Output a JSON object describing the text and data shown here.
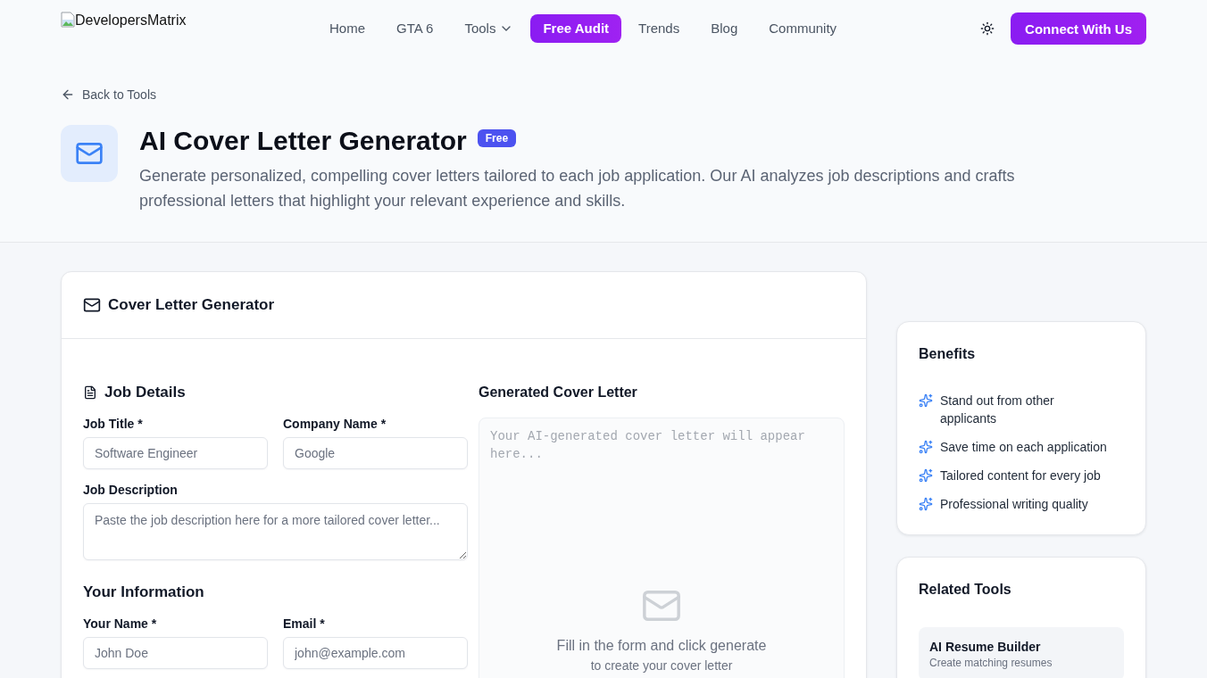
{
  "header": {
    "logo_alt": "DevelopersMatrix",
    "nav": [
      {
        "label": "Home",
        "kind": "link"
      },
      {
        "label": "GTA 6",
        "kind": "link"
      },
      {
        "label": "Tools",
        "kind": "dropdown"
      },
      {
        "label": "Free Audit",
        "kind": "highlight"
      },
      {
        "label": "Trends",
        "kind": "link"
      },
      {
        "label": "Blog",
        "kind": "link"
      },
      {
        "label": "Community",
        "kind": "link"
      }
    ],
    "cta": "Connect With Us"
  },
  "back_link": "Back to Tools",
  "hero": {
    "title": "AI Cover Letter Generator",
    "badge": "Free",
    "description": "Generate personalized, compelling cover letters tailored to each job application. Our AI analyzes job descriptions and crafts professional letters that highlight your relevant experience and skills."
  },
  "generator": {
    "title": "Cover Letter Generator",
    "job_details": {
      "heading": "Job Details",
      "fields": [
        {
          "label": "Job Title *",
          "placeholder": "Software Engineer",
          "kind": "input"
        },
        {
          "label": "Company Name *",
          "placeholder": "Google",
          "kind": "input"
        },
        {
          "label": "Job Description",
          "placeholder": "Paste the job description here for a more tailored cover letter...",
          "kind": "textarea"
        }
      ]
    },
    "your_information": {
      "heading": "Your Information",
      "fields": [
        {
          "label": "Your Name *",
          "placeholder": "John Doe",
          "kind": "input"
        },
        {
          "label": "Email *",
          "placeholder": "john@example.com",
          "kind": "input"
        }
      ]
    },
    "output": {
      "heading": "Generated Cover Letter",
      "placeholder": "Your AI-generated cover letter will appear here...",
      "empty_message": "Fill in the form and click generate",
      "empty_hint": "to create your cover letter"
    }
  },
  "benefits": {
    "title": "Benefits",
    "items": [
      "Stand out from other applicants",
      "Save time on each application",
      "Tailored content for every job",
      "Professional writing quality"
    ]
  },
  "related_tools": {
    "title": "Related Tools",
    "items": [
      {
        "name": "AI Resume Builder",
        "description": "Create matching resumes"
      }
    ]
  }
}
